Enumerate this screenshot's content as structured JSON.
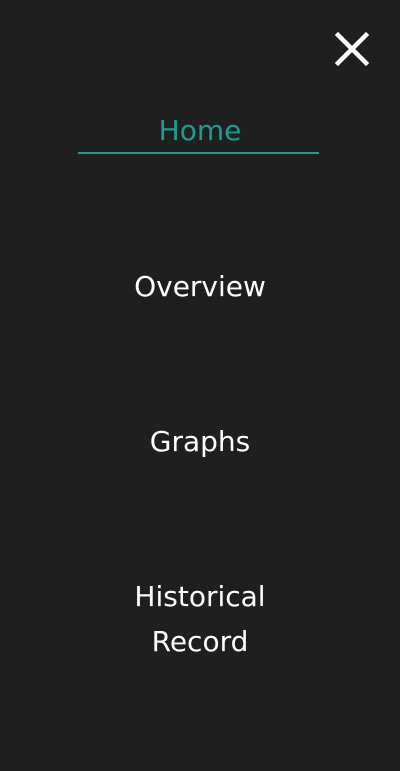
{
  "menu": {
    "close_icon": "close-icon",
    "items": [
      {
        "label": "Home",
        "active": true
      },
      {
        "label": "Overview",
        "active": false
      },
      {
        "label": "Graphs",
        "active": false
      },
      {
        "label": "Historical Record",
        "active": false,
        "lines": [
          "Historical",
          "Record"
        ]
      }
    ]
  },
  "colors": {
    "background": "#1f1f1f",
    "text": "#ffffff",
    "accent": "#1e9a90"
  }
}
